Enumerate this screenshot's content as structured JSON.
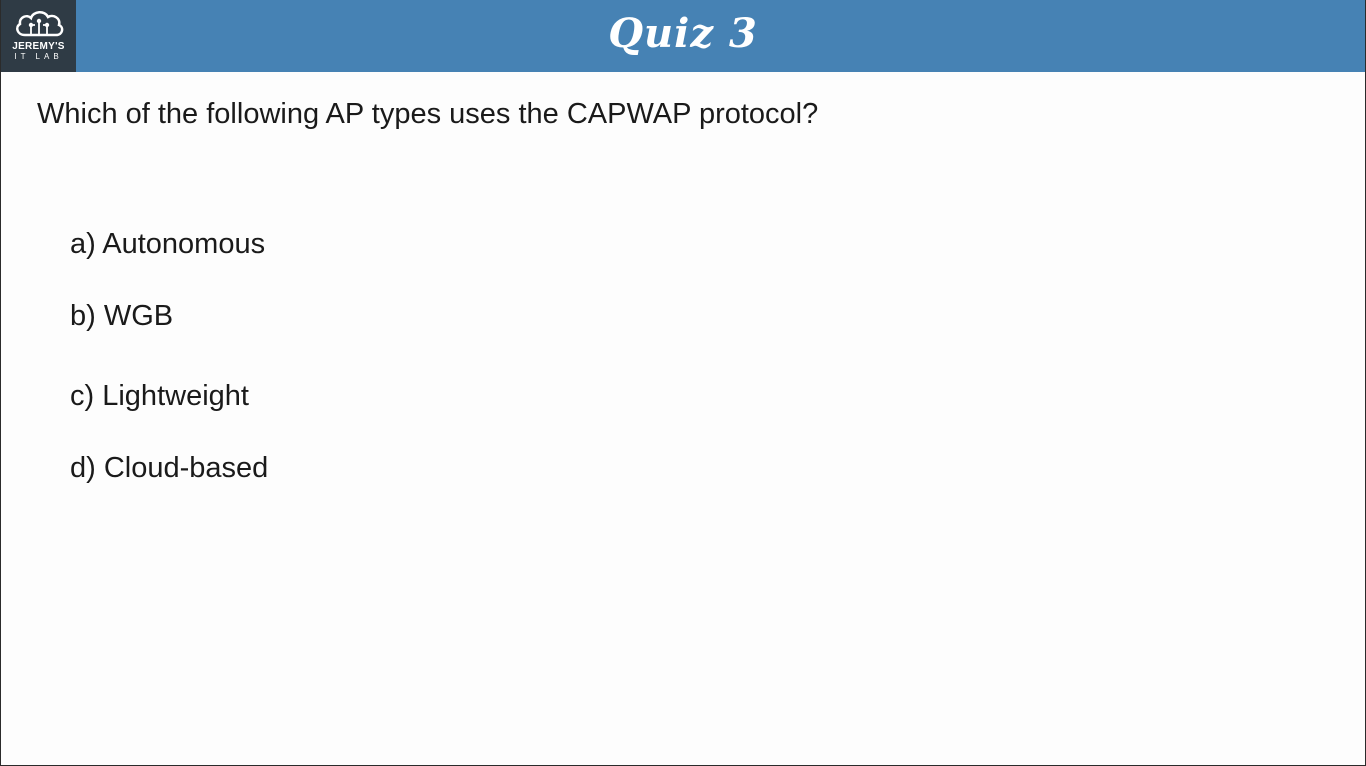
{
  "header": {
    "logo": {
      "line1": "JEREMY'S",
      "line2": "IT LAB",
      "icon": "cloud-circuit-icon"
    },
    "title": "Quiz 3",
    "background_color": "#4682b4"
  },
  "quiz": {
    "question": "Which of the following AP types uses the CAPWAP protocol?",
    "options": [
      {
        "letter": "a)",
        "text": "Autonomous"
      },
      {
        "letter": "b)",
        "text": "WGB"
      },
      {
        "letter": "c)",
        "text": "Lightweight"
      },
      {
        "letter": "d)",
        "text": "Cloud-based"
      }
    ]
  }
}
